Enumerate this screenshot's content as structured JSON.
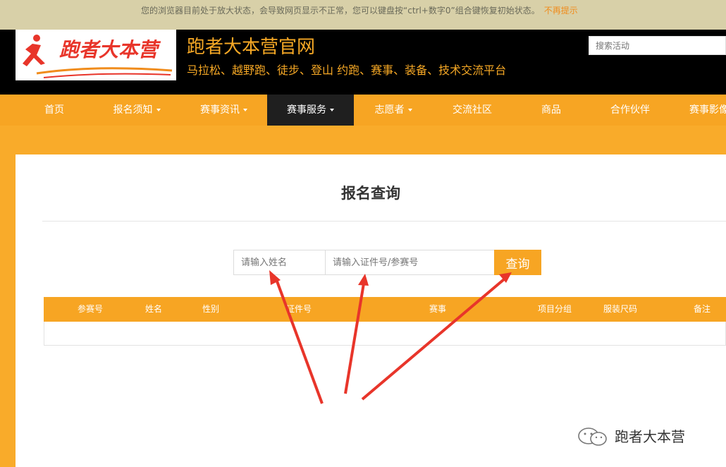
{
  "zoom_notice": {
    "message": "您的浏览器目前处于放大状态，会导致网页显示不正常，您可以键盘按“ctrl+数字0”组合键恢复初始状态。",
    "dismiss": "不再提示"
  },
  "header": {
    "logo_text": "跑者大本营",
    "site_title": "跑者大本营官网",
    "subtitle": "马拉松、越野跑、徒步、登山 约跑、赛事、装备、技术交流平台",
    "search_placeholder": "搜索活动"
  },
  "nav": {
    "items": [
      {
        "label": "首页",
        "dropdown": false
      },
      {
        "label": "报名须知",
        "dropdown": true
      },
      {
        "label": "赛事资讯",
        "dropdown": true
      },
      {
        "label": "赛事服务",
        "dropdown": true,
        "active": true
      },
      {
        "label": "志愿者",
        "dropdown": true
      },
      {
        "label": "交流社区",
        "dropdown": false
      },
      {
        "label": "商品",
        "dropdown": false
      },
      {
        "label": "合作伙伴",
        "dropdown": false
      },
      {
        "label": "赛事影像",
        "dropdown": false
      }
    ]
  },
  "main": {
    "title": "报名查询",
    "name_placeholder": "请输入姓名",
    "id_placeholder": "请输入证件号/参赛号",
    "query_button": "查询",
    "table_headers": [
      "参赛号",
      "姓名",
      "性别",
      "证件号",
      "赛事",
      "项目分组",
      "服装尺码",
      "备注"
    ]
  },
  "watermark": {
    "text": "跑者大本营"
  },
  "colors": {
    "accent": "#f7a523",
    "header_bg": "#000000",
    "nav_active": "#1f1f1f",
    "arrow": "#e8352a"
  }
}
